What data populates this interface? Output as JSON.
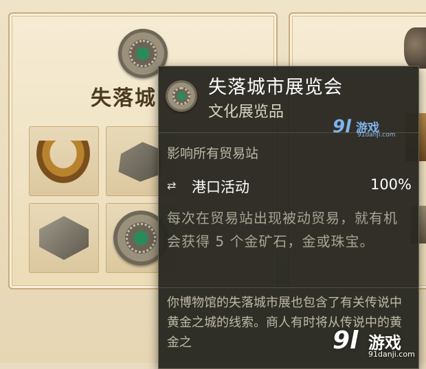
{
  "collection_card": {
    "title": "失落城"
  },
  "tooltip": {
    "title": "失落城市展览会",
    "subtitle": "文化展览品",
    "affect_label": "影响所有贸易站",
    "effect": {
      "icon": "swap-arrows-icon",
      "label": "港口活动",
      "value": "100%"
    },
    "description": "每次在贸易站出现被动贸易，就有机会获得 5 个金矿石，金或珠宝。",
    "lore": "你博物馆的失落城市展也包含了有关传说中黄金之城的线索。商人有时将从传说中的黄金之"
  },
  "watermarks": {
    "top": {
      "logo": "9l",
      "text": "游戏",
      "url": "91danji.com"
    },
    "bottom": {
      "logo": "9l",
      "text": "游戏",
      "url": "91danji.com"
    }
  },
  "colors": {
    "tooltip_bg": "#292821",
    "title_text": "#ffffff",
    "description_text": "#a9a594",
    "card_bg": "#f2e6cc"
  }
}
